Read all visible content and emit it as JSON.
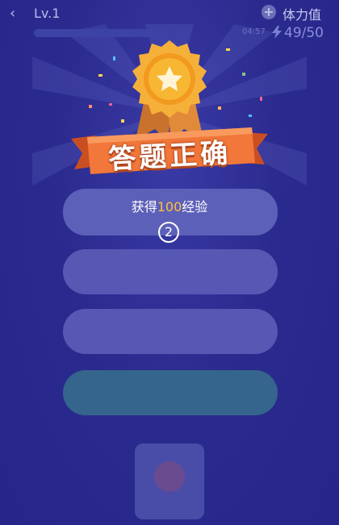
{
  "header": {
    "back_icon": "chevron-left-icon",
    "level": "Lv.1",
    "stamina_label": "体力值",
    "timer": "04:57",
    "stamina_count": "49/50"
  },
  "result": {
    "title": "答题正确",
    "reward_prefix": "获得",
    "reward_amount": "100",
    "reward_suffix": "经验",
    "countdown": "2"
  },
  "colors": {
    "background": "#2b2b8f",
    "medal_gold": "#f2a62a",
    "banner_orange": "#f0763a",
    "reward_highlight": "#ffbf3c"
  }
}
